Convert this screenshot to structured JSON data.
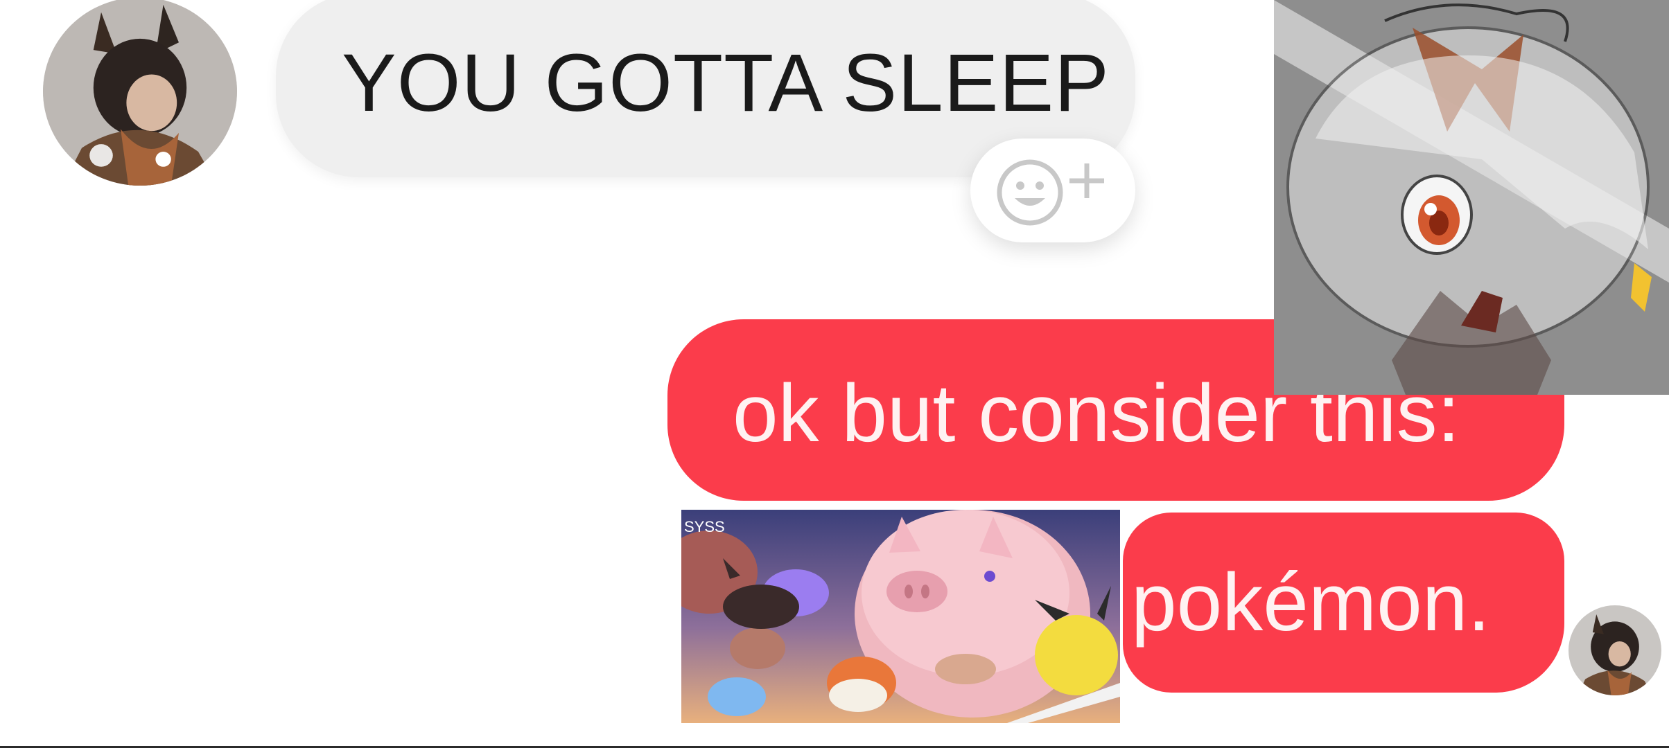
{
  "messages": {
    "incoming": {
      "text": "YOU GOTTA SLEEP",
      "avatar_icon": "anime-character-avatar",
      "reaction_icon": "add-reaction-icon"
    },
    "outgoing": [
      {
        "text": "ok but consider this:"
      },
      {
        "text": "pokémon."
      }
    ],
    "outgoing_avatar_icon": "anime-character-avatar",
    "attached_image": {
      "corner_text": "SYSS"
    }
  },
  "colors": {
    "incoming_bubble": "#efefef",
    "outgoing_bubble": "#fb3c4b",
    "outgoing_text": "#fff2f2",
    "background": "#ffffff"
  }
}
